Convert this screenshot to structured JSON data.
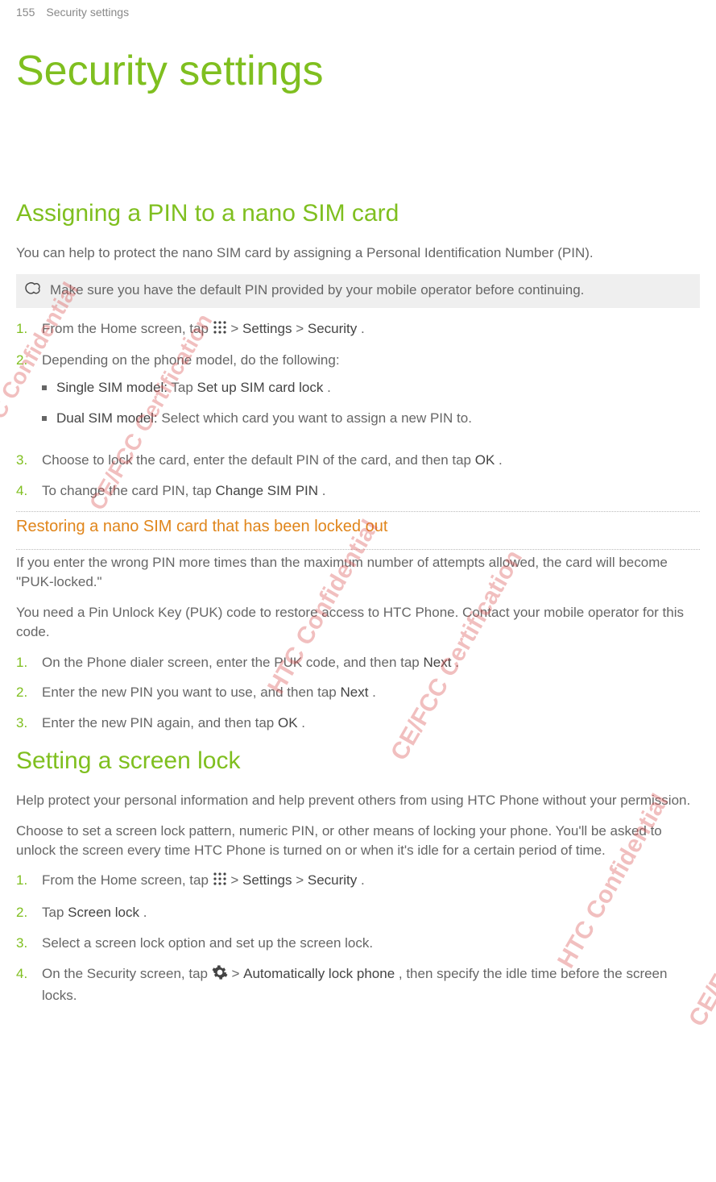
{
  "header": {
    "page_num": "155",
    "section": "Security settings"
  },
  "title": "Security settings",
  "section1": {
    "heading": "Assigning a PIN to a nano SIM card",
    "intro": "You can help to protect the nano SIM card by assigning a Personal Identification Number (PIN).",
    "note": "Make sure you have the default PIN provided by your mobile operator before continuing.",
    "step1_a": "From the Home screen, tap ",
    "step1_b": " > ",
    "step1_settings": "Settings",
    "step1_c": " > ",
    "step1_security": "Security",
    "step1_end": ".",
    "step2": "Depending on the phone model, do the following:",
    "step2_sub1_strong": "Single SIM model:",
    "step2_sub1_rest": " Tap ",
    "step2_sub1_action": "Set up SIM card lock",
    "step2_sub1_end": ".",
    "step2_sub2_strong": "Dual SIM model:",
    "step2_sub2_rest": " Select which card you want to assign a new PIN to.",
    "step3_a": "Choose to lock the card, enter the default PIN of the card, and then tap ",
    "step3_ok": "OK",
    "step3_end": ".",
    "step4_a": "To change the card PIN, tap ",
    "step4_change": "Change SIM PIN",
    "step4_end": "."
  },
  "sub1": {
    "heading": "Restoring a nano SIM card that has been locked out",
    "para1": "If you enter the wrong PIN more times than the maximum number of attempts allowed, the card will become \"PUK-locked.\"",
    "para2": "You need a Pin Unlock Key (PUK) code to restore access to HTC Phone. Contact your mobile operator for this code.",
    "step1_a": "On the Phone dialer screen, enter the PUK code, and then tap ",
    "step1_next": "Next",
    "step1_end": ".",
    "step2_a": "Enter the new PIN you want to use, and then tap ",
    "step2_next": "Next",
    "step2_end": ".",
    "step3_a": "Enter the new PIN again, and then tap ",
    "step3_ok": "OK",
    "step3_end": "."
  },
  "section2": {
    "heading": "Setting a screen lock",
    "para1": "Help protect your personal information and help prevent others from using HTC Phone without your permission.",
    "para2": "Choose to set a screen lock pattern, numeric PIN, or other means of locking your phone. You'll be asked to unlock the screen every time HTC Phone is turned on or when it's idle for a certain period of time.",
    "step1_a": "From the Home screen, tap ",
    "step1_b": " > ",
    "step1_settings": "Settings",
    "step1_c": " > ",
    "step1_security": "Security",
    "step1_end": ".",
    "step2_a": "Tap ",
    "step2_screenlock": "Screen lock",
    "step2_end": ".",
    "step3": "Select a screen lock option and set up the screen lock.",
    "step4_a": "On the Security screen, tap ",
    "step4_b": " > ",
    "step4_autolock": "Automatically lock phone",
    "step4_c": ", then specify the idle time before the screen locks."
  },
  "nums": {
    "n1": "1.",
    "n2": "2.",
    "n3": "3.",
    "n4": "4."
  },
  "watermark": {
    "conf": "HTC Confidential",
    "cert": "CE/FCC Certification"
  }
}
